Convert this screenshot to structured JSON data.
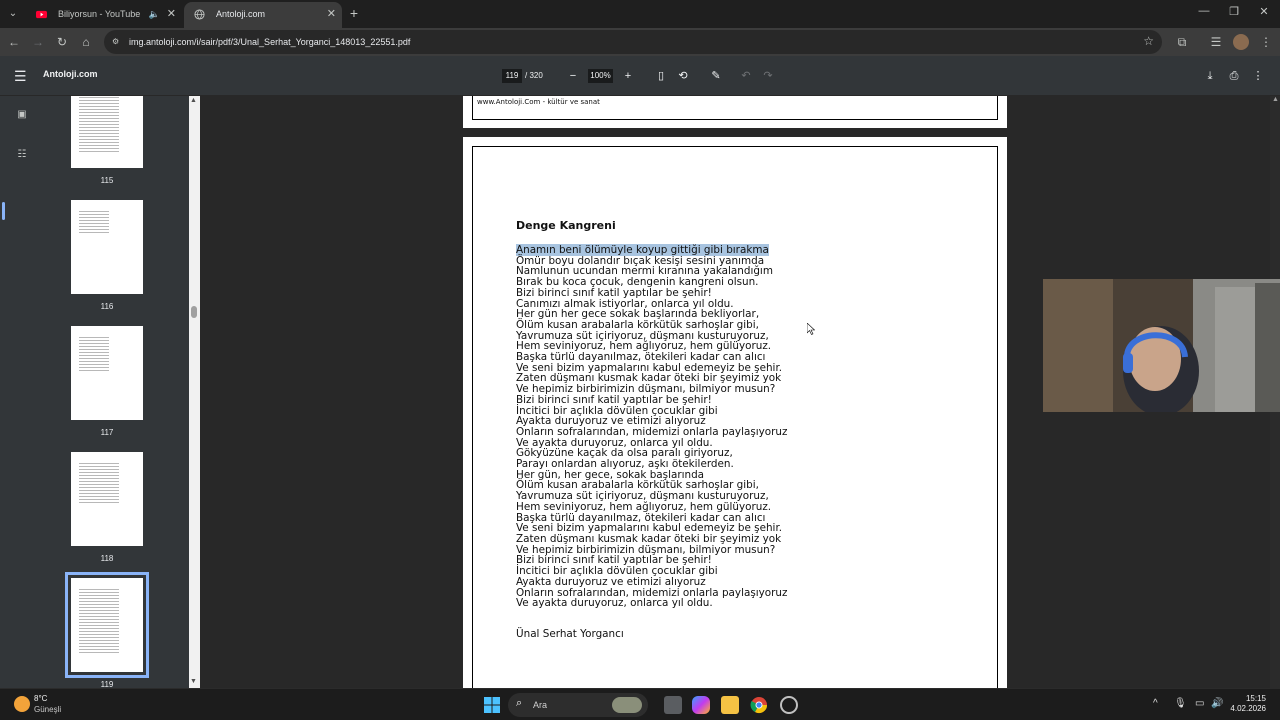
{
  "tabs": [
    {
      "title": "Biliyorsun - YouTube",
      "active": false
    },
    {
      "title": "Antoloji.com",
      "active": true
    }
  ],
  "address": {
    "url": "img.antoloji.com/i/sair/pdf/3/Unal_Serhat_Yorganci_148013_22551.pdf"
  },
  "pdf_toolbar": {
    "title": "Antoloji.com",
    "page_current": "119",
    "page_total": "/ 320",
    "zoom": "100%"
  },
  "thumbnails": [
    {
      "label": "115"
    },
    {
      "label": "116"
    },
    {
      "label": "117"
    },
    {
      "label": "118"
    },
    {
      "label": "119"
    }
  ],
  "prev_page": {
    "footer": "www.Antoloji.Com - kültür ve sanat"
  },
  "page": {
    "title": "Denge Kangreni",
    "lines": [
      "Anamın beni ölümüyle koyup gittiği gibi bırakma",
      "Ömür boyu dolandır bıçak kesişi sesini yanımda",
      "Namlunun ucundan mermi kıranına yakalandığım",
      "Bırak bu koca çocuk, dengenin kangreni olsun.",
      "Bizi birinci sınıf katil yaptılar be şehir!",
      "Canımızı almak istiyorlar, onlarca yıl oldu.",
      "Her gün her gece sokak başlarında bekliyorlar,",
      "Ölüm kusan arabalarla körkütük sarhoşlar gibi,",
      "Yavrumuza süt içiriyoruz, düşmanı kusturuyoruz,",
      "Hem seviniyoruz, hem ağlıyoruz, hem gülüyoruz.",
      "Başka türlü dayanılmaz, ötekileri kadar can alıcı",
      "Ve seni bizim yapmalarını kabul edemeyiz be şehir.",
      "Zaten düşmanı kusmak kadar öteki bir şeyimiz yok",
      "Ve hepimiz birbirimizin düşmanı, bilmiyor musun?",
      "Bizi birinci sınıf katil yaptılar be şehir!",
      "İncitici bir açlıkla dövülen çocuklar gibi",
      "Ayakta duruyoruz ve etimizi alıyoruz",
      "Onların sofralarından, midemizi onlarla paylaşıyoruz",
      "Ve ayakta duruyoruz, onlarca yıl oldu.",
      "Gökyüzüne kaçak da olsa paralı giriyoruz,",
      "Parayı onlardan alıyoruz, aşkı ötekilerden.",
      "Her gün, her gece, sokak başlarında",
      "Ölüm kusan arabalarla körkütük sarhoşlar gibi,",
      "Yavrumuza süt içiriyoruz, düşmanı kusturuyoruz,",
      "Hem seviniyoruz, hem ağlıyoruz, hem gülüyoruz.",
      "Başka türlü dayanılmaz, ötekileri kadar can alıcı",
      "Ve seni bizim yapmalarını kabul edemeyiz be şehir.",
      "Zaten düşmanı kusmak kadar öteki bir şeyimiz yok",
      "Ve hepimiz birbirimizin düşmanı, bilmiyor musun?",
      "Bizi birinci sınıf katil yaptılar be şehir!",
      "İncitici bir açlıkla dövülen çocuklar gibi",
      "Ayakta duruyoruz ve etimizi alıyoruz",
      "Onların sofralarından, midemizi onlarla paylaşıyoruz",
      "Ve ayakta duruyoruz, onlarca yıl oldu."
    ],
    "author": "Ünal Serhat Yorgancı"
  },
  "taskbar": {
    "temp": "8°C",
    "weather": "Güneşli",
    "search": "Ara",
    "time": "15:15",
    "date": "4.02.2026"
  },
  "colors": {
    "selection": "#a8c4e0",
    "accent": "#8ab4f8",
    "viewer_bg": "#282828",
    "toolbar_bg": "#323639"
  }
}
